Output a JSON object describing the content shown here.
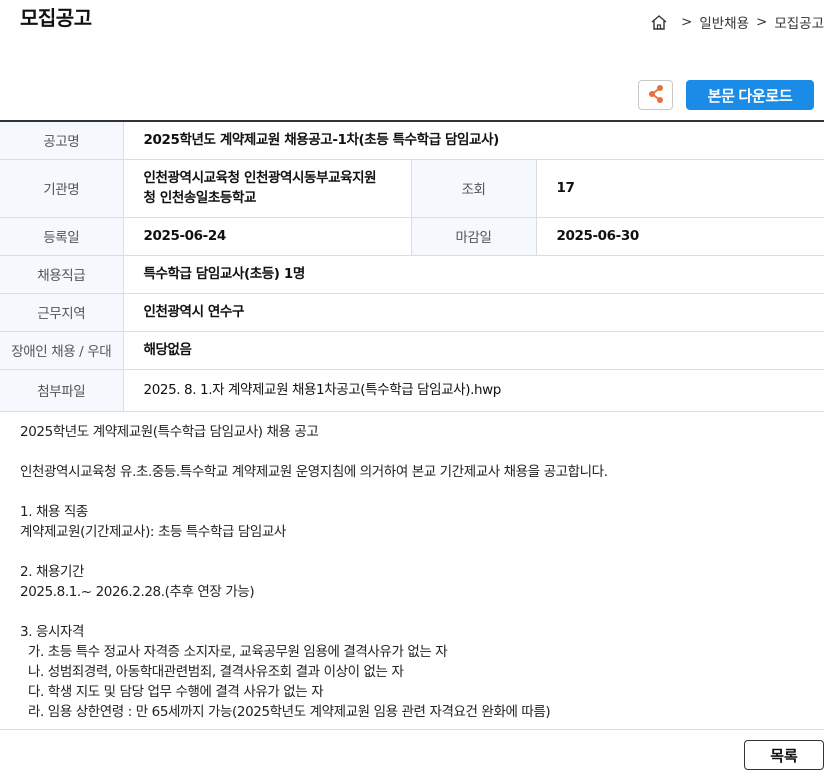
{
  "page": {
    "title": "모집공고"
  },
  "breadcrumb": {
    "items": [
      "일반채용",
      "모집공고"
    ],
    "separator": ">"
  },
  "actions": {
    "download_label": "본문 다운로드",
    "list_label": "목록"
  },
  "colors": {
    "accent": "#1a8be6",
    "share_icon": "#e8703a"
  },
  "info": {
    "notice_name_label": "공고명",
    "notice_name": "2025학년도 계약제교원 채용공고-1차(초등 특수학급 담임교사)",
    "agency_label": "기관명",
    "agency_line1": "인천광역시교육청 인천광역시동부교육지원",
    "agency_line2": "청 인천송일초등학교",
    "views_label": "조회",
    "views": "17",
    "reg_date_label": "등록일",
    "reg_date": "2025-06-24",
    "deadline_label": "마감일",
    "deadline": "2025-06-30",
    "position_label": "채용직급",
    "position": "특수학급 담임교사(초등) 1명",
    "region_label": "근무지역",
    "region": "인천광역시 연수구",
    "disability_label": "장애인 채용 / 우대",
    "disability": "해당없음",
    "attachment_label": "첨부파일",
    "attachment": "2025. 8. 1.자 계약제교원 채용1차공고(특수학급 담임교사).hwp"
  },
  "body": {
    "lines": [
      "2025학년도 계약제교원(특수학급 담임교사)  채용 공고",
      "",
      "인천광역시교육청 유.초.중등.특수학교 계약제교원 운영지침에 의거하여 본교 기간제교사 채용을 공고합니다.",
      "",
      "1. 채용 직종",
      "계약제교원(기간제교사): 초등 특수학급 담임교사",
      "",
      "2. 채용기간",
      "2025.8.1.~ 2026.2.28.(추후 연장 가능)",
      "",
      "3. 응시자격",
      "가. 초등 특수 정교사 자격증 소지자로, 교육공무원 임용에 결격사유가 없는 자",
      "나. 성범죄경력, 아동학대관련범죄, 결격사유조회 결과 이상이 없는 자",
      "다. 학생 지도 및 담당 업무 수행에 결격 사유가 없는 자",
      "라. 임용 상한연령 : 만 65세까지 가능(2025학년도 계약제교원 임용 관련 자격요건 완화에 따름)"
    ]
  }
}
